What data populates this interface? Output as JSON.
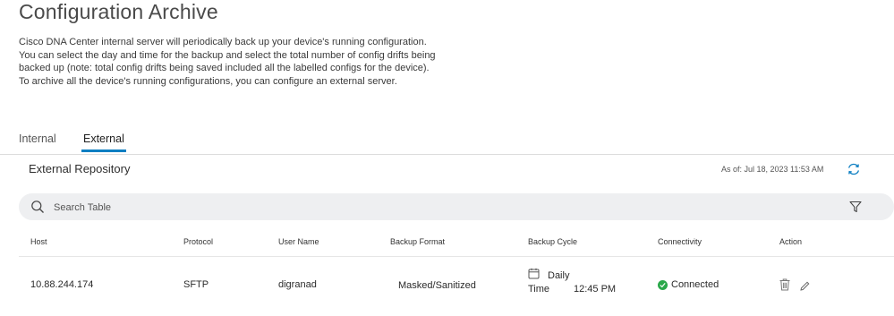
{
  "page": {
    "title": "Configuration Archive",
    "description": "Cisco DNA Center internal server will periodically back up your device's running configuration. You can select the day and time for the backup and select the total number of config drifts being backed up (note: total config drifts being saved included all the labelled configs for the device). To archive all the device's running configurations, you can configure an external server."
  },
  "tabs": [
    {
      "label": "Internal",
      "active": false
    },
    {
      "label": "External",
      "active": true
    }
  ],
  "repository": {
    "title": "External Repository",
    "as_of": "As of: Jul 18, 2023 11:53 AM",
    "refresh_icon": "refresh-icon"
  },
  "search": {
    "placeholder": "Search Table",
    "value": ""
  },
  "table": {
    "columns": [
      "Host",
      "Protocol",
      "User Name",
      "Backup Format",
      "Backup Cycle",
      "Connectivity",
      "Action"
    ],
    "rows": [
      {
        "host": "10.88.244.174",
        "protocol": "SFTP",
        "user_name": "digranad",
        "backup_format": "Masked/Sanitized",
        "cycle": "Daily",
        "time_label": "Time",
        "time_value": "12:45 PM",
        "connectivity": "Connected"
      }
    ]
  },
  "colors": {
    "accent": "#0d7fc2",
    "status_connected": "#2aa84a",
    "search_bg": "#eeeff1"
  }
}
